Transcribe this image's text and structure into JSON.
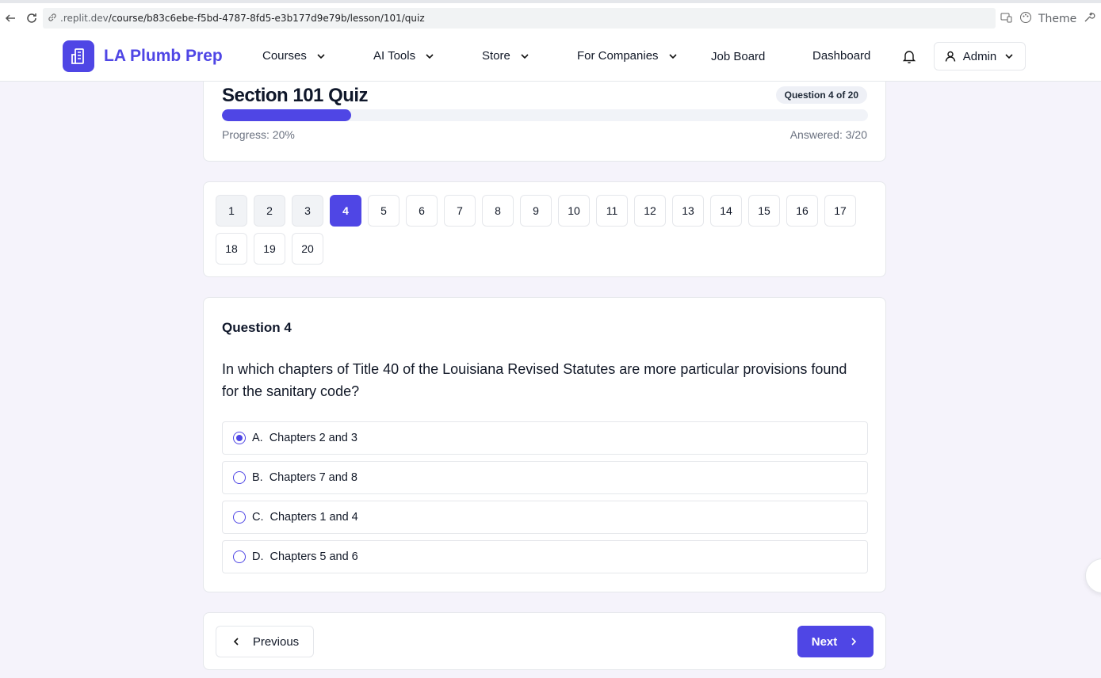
{
  "browser": {
    "url_host": ".replit.dev",
    "url_path": "/course/b83c6ebe-f5bd-4787-8fd5-e3b177d9e79b/lesson/101/quiz",
    "theme_label": "Theme"
  },
  "header": {
    "logo_text": "LA Plumb Prep",
    "nav": {
      "courses": "Courses",
      "ai_tools": "AI Tools",
      "store": "Store",
      "for_companies": "For Companies",
      "job_board": "Job Board",
      "dashboard": "Dashboard"
    },
    "user_label": "Admin"
  },
  "quiz": {
    "title": "Section 101 Quiz",
    "badge": "Question 4 of 20",
    "progress_label": "Progress: 20%",
    "progress_fraction": 0.2,
    "answered_label": "Answered: 3/20"
  },
  "question_numbers": [
    {
      "label": "1",
      "state": "answered"
    },
    {
      "label": "2",
      "state": "answered"
    },
    {
      "label": "3",
      "state": "answered"
    },
    {
      "label": "4",
      "state": "current"
    },
    {
      "label": "5",
      "state": "default"
    },
    {
      "label": "6",
      "state": "default"
    },
    {
      "label": "7",
      "state": "default"
    },
    {
      "label": "8",
      "state": "default"
    },
    {
      "label": "9",
      "state": "default"
    },
    {
      "label": "10",
      "state": "default"
    },
    {
      "label": "11",
      "state": "default"
    },
    {
      "label": "12",
      "state": "default"
    },
    {
      "label": "13",
      "state": "default"
    },
    {
      "label": "14",
      "state": "default"
    },
    {
      "label": "15",
      "state": "default"
    },
    {
      "label": "16",
      "state": "default"
    },
    {
      "label": "17",
      "state": "default"
    },
    {
      "label": "18",
      "state": "default"
    },
    {
      "label": "19",
      "state": "default"
    },
    {
      "label": "20",
      "state": "default"
    }
  ],
  "question": {
    "label": "Question 4",
    "text": "In which chapters of Title 40 of the Louisiana Revised Statutes are more particular provisions found for the sanitary code?",
    "options": [
      {
        "letter": "A.",
        "text": "Chapters 2 and 3",
        "selected": true
      },
      {
        "letter": "B.",
        "text": "Chapters 7 and 8",
        "selected": false
      },
      {
        "letter": "C.",
        "text": "Chapters 1 and 4",
        "selected": false
      },
      {
        "letter": "D.",
        "text": "Chapters 5 and 6",
        "selected": false
      }
    ]
  },
  "navigation": {
    "previous_label": "Previous",
    "next_label": "Next"
  },
  "colors": {
    "accent": "#4f46e5",
    "background": "#f5f3fb"
  }
}
